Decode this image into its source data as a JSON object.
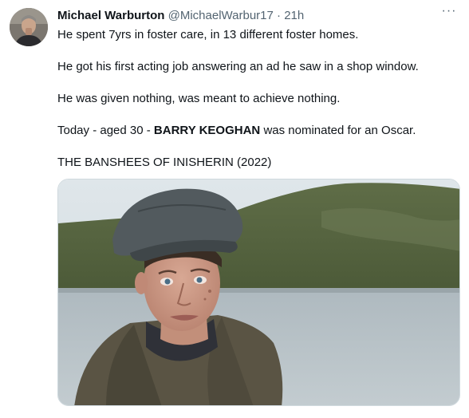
{
  "tweet": {
    "author_name": "Michael Warburton",
    "handle": "@MichaelWarbur17",
    "separator": "·",
    "time": "21h",
    "more_label": "···",
    "lines": [
      "He spent 7yrs in foster care, in 13 different foster homes.",
      "He got his first acting job answering an ad he saw in a shop window.",
      "He was given nothing, was meant to achieve nothing."
    ],
    "today_prefix": "Today - aged 30 - ",
    "today_bold": "BARRY KEOGHAN",
    "today_suffix": " was nominated for an Oscar.",
    "film_title": "THE BANSHEES OF INISHERIN (2022)"
  },
  "icons": {
    "avatar": "avatar-photo",
    "more": "more-options-icon"
  },
  "colors": {
    "secondary_text": "#536471",
    "border": "#cfd9de"
  }
}
